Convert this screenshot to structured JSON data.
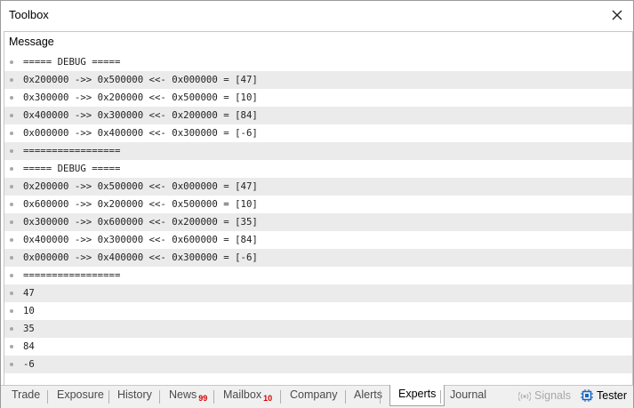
{
  "window": {
    "title": "Toolbox"
  },
  "column": {
    "header": "Message"
  },
  "rows": [
    "===== DEBUG =====",
    "0x200000 ->> 0x500000 <<- 0x000000 = [47]",
    "0x300000 ->> 0x200000 <<- 0x500000 = [10]",
    "0x400000 ->> 0x300000 <<- 0x200000 = [84]",
    "0x000000 ->> 0x400000 <<- 0x300000 = [-6]",
    "=================",
    "===== DEBUG =====",
    "0x200000 ->> 0x500000 <<- 0x000000 = [47]",
    "0x600000 ->> 0x200000 <<- 0x500000 = [10]",
    "0x300000 ->> 0x600000 <<- 0x200000 = [35]",
    "0x400000 ->> 0x300000 <<- 0x600000 = [84]",
    "0x000000 ->> 0x400000 <<- 0x300000 = [-6]",
    "=================",
    "47",
    "10",
    "35",
    "84",
    "-6"
  ],
  "tabs": [
    {
      "label": "Trade"
    },
    {
      "label": "Exposure"
    },
    {
      "label": "History"
    },
    {
      "label": "News",
      "badge": "99"
    },
    {
      "label": "Mailbox",
      "badge": "10"
    },
    {
      "label": "Company"
    },
    {
      "label": "Alerts"
    },
    {
      "label": "Experts",
      "active": true
    },
    {
      "label": "Journal"
    }
  ],
  "right_items": {
    "signals": "Signals",
    "tester": "Tester"
  },
  "icons": {
    "close": "close-icon",
    "signals": "signals-icon",
    "tester": "tester-icon"
  },
  "colors": {
    "alt_row": "#ebebeb",
    "badge": "#d40000",
    "tester_icon": "#1565c0"
  }
}
